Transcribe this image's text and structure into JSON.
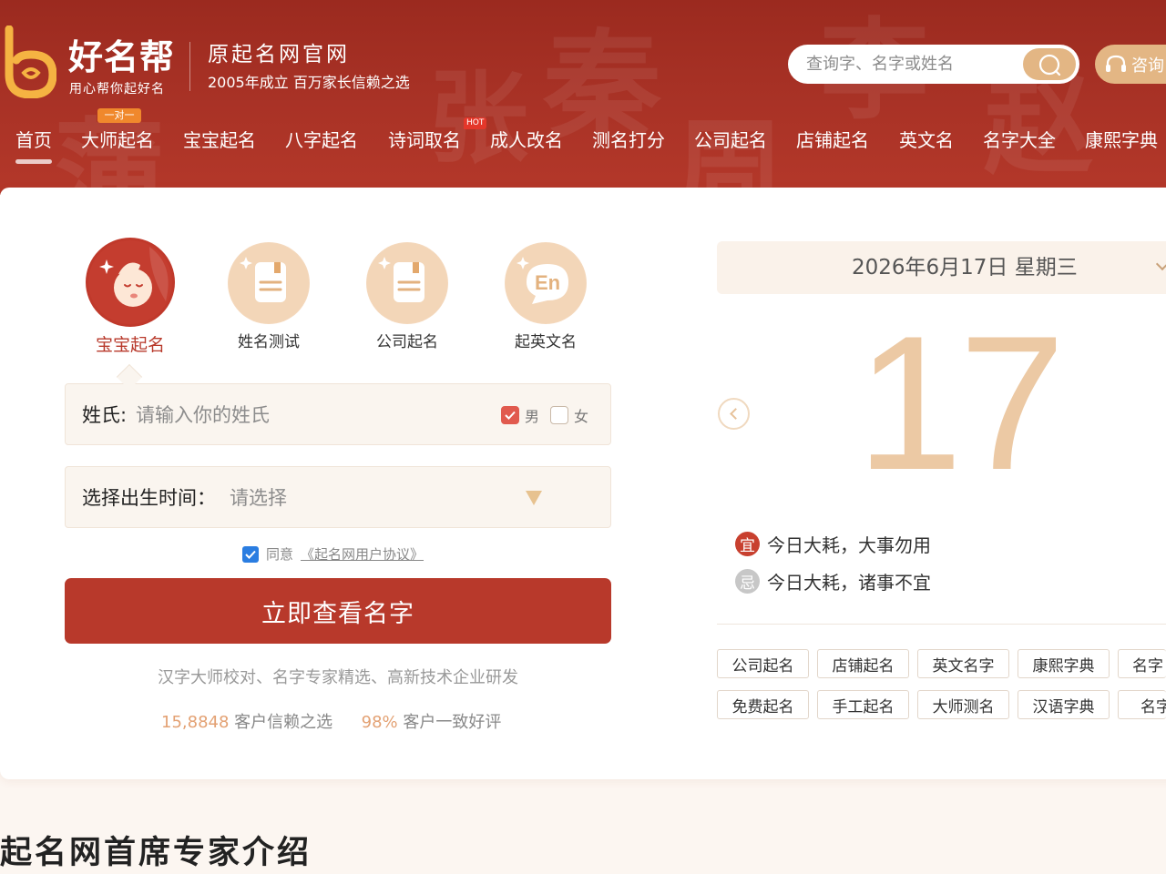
{
  "header": {
    "brand": "好名帮",
    "slogan": "用心帮你起好名",
    "site_title": "原起名网官网",
    "site_subtitle": "2005年成立 百万家长信赖之选",
    "search_placeholder": "查询字、名字或姓名",
    "consult_label": "咨询",
    "accent_color": "#a73125"
  },
  "nav": {
    "items": [
      "首页",
      "大师起名",
      "宝宝起名",
      "八字起名",
      "诗词取名",
      "成人改名",
      "测名打分",
      "公司起名",
      "店铺起名",
      "英文名",
      "名字大全",
      "康熙字典"
    ],
    "badge_master": "一对一",
    "badge_hot": "HOT"
  },
  "categories": [
    {
      "label": "宝宝起名",
      "icon": "baby-face-icon"
    },
    {
      "label": "姓名测试",
      "icon": "document-icon"
    },
    {
      "label": "公司起名",
      "icon": "document-icon"
    },
    {
      "label": "起英文名",
      "icon": "english-bubble-icon"
    }
  ],
  "form": {
    "surname_label": "姓氏:",
    "surname_placeholder": "请输入你的姓氏",
    "gender_male": "男",
    "gender_female": "女",
    "birth_label": "选择出生时间：",
    "birth_placeholder": "请选择",
    "agree_text": "同意",
    "agreement_link": "《起名网用户协议》",
    "submit_label": "立即查看名字",
    "tagline": "汉字大师校对、名字专家精选、高新技术企业研发",
    "stat_customers_num": "15,8848",
    "stat_customers_text": "客户信赖之选",
    "stat_rating_num": "98%",
    "stat_rating_text": "客户一致好评"
  },
  "calendar": {
    "date": "2026年6月17日 星期三",
    "day": "17",
    "yi_label": "宜",
    "yi_text": "今日大耗，大事勿用",
    "ji_label": "忌",
    "ji_text": "今日大耗，诸事不宜",
    "tags_row1": [
      "公司起名",
      "店铺起名",
      "英文名字",
      "康熙字典",
      "名字"
    ],
    "tags_row2": [
      "免费起名",
      "手工起名",
      "大师测名",
      "汉语字典",
      "名字"
    ]
  },
  "section": {
    "title": "起名网首席专家介绍"
  }
}
